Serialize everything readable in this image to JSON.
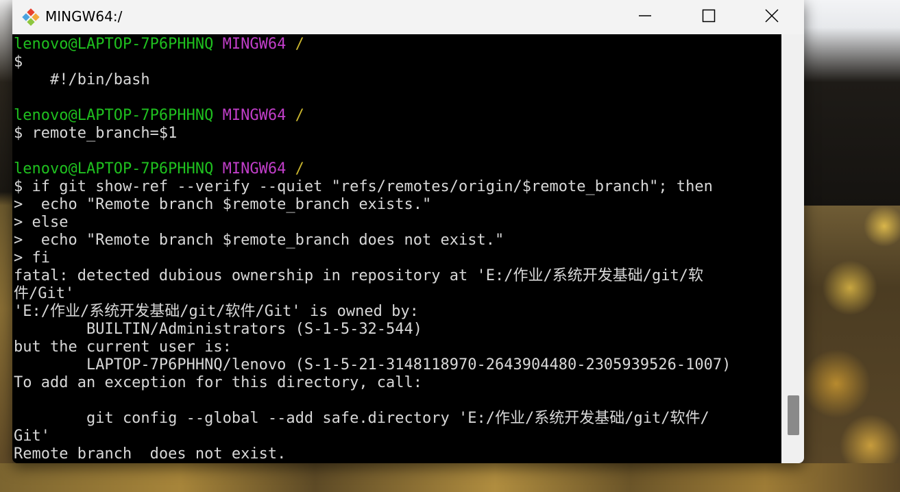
{
  "window": {
    "title": "MINGW64:/",
    "icon": "git-bash-icon",
    "controls": {
      "minimize": "minimize-icon",
      "maximize": "maximize-icon",
      "close": "close-icon"
    }
  },
  "colors": {
    "prompt_user": "#1fc01f",
    "prompt_system": "#c13ec9",
    "prompt_path": "#c9b52e",
    "text": "#d8d8d8",
    "background": "#000000"
  },
  "terminal": {
    "prompt1": {
      "user": "lenovo@LAPTOP-7P6PHHNQ",
      "system": "MINGW64",
      "path": "/"
    },
    "cmd1": "$",
    "out1": "    #!/bin/bash",
    "prompt2": {
      "user": "lenovo@LAPTOP-7P6PHHNQ",
      "system": "MINGW64",
      "path": "/"
    },
    "cmd2": "$ remote_branch=$1",
    "prompt3": {
      "user": "lenovo@LAPTOP-7P6PHHNQ",
      "system": "MINGW64",
      "path": "/"
    },
    "cmd3": "$ if git show-ref --verify --quiet \"refs/remotes/origin/$remote_branch\"; then",
    "cont1": ">  echo \"Remote branch $remote_branch exists.\"",
    "cont2": "> else",
    "cont3": ">  echo \"Remote branch $remote_branch does not exist.\"",
    "cont4": "> fi",
    "err1": "fatal: detected dubious ownership in repository at 'E:/作业/系统开发基础/git/软",
    "err2": "件/Git'",
    "err3": "'E:/作业/系统开发基础/git/软件/Git' is owned by:",
    "err4": "        BUILTIN/Administrators (S-1-5-32-544)",
    "err5": "but the current user is:",
    "err6": "        LAPTOP-7P6PHHNQ/lenovo (S-1-5-21-3148118970-2643904480-2305939526-1007)",
    "err7": "To add an exception for this directory, call:",
    "err8": "        git config --global --add safe.directory 'E:/作业/系统开发基础/git/软件/",
    "err9": "Git'",
    "result": "Remote branch  does not exist."
  }
}
